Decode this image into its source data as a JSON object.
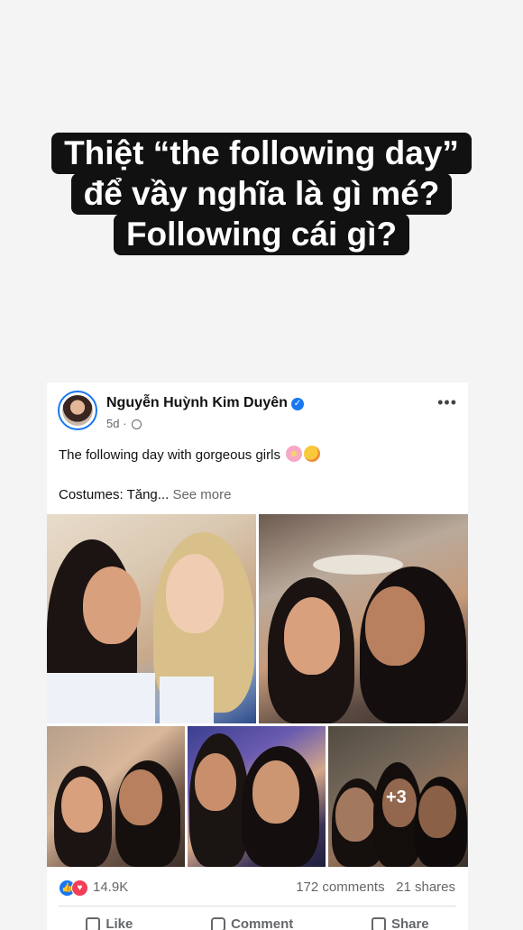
{
  "caption": {
    "line1": "Thiệt “the following day”",
    "line2": "để vầy nghĩa là gì mé?",
    "line3": "Following cái gì?"
  },
  "post": {
    "author": "Nguyễn Huỳnh Kim Duyên",
    "time": "5d ·",
    "text": "The following day with gorgeous girls",
    "text2": "Costumes: Tăng...",
    "see_more": "See more",
    "more_photos": "+3",
    "reactions_count": "14.9K",
    "comments": "172 comments",
    "shares": "21 shares",
    "actions": {
      "like": "Like",
      "comment": "Comment",
      "share": "Share"
    },
    "colors": {
      "accent": "#1877f2",
      "love": "#f33e58"
    }
  }
}
